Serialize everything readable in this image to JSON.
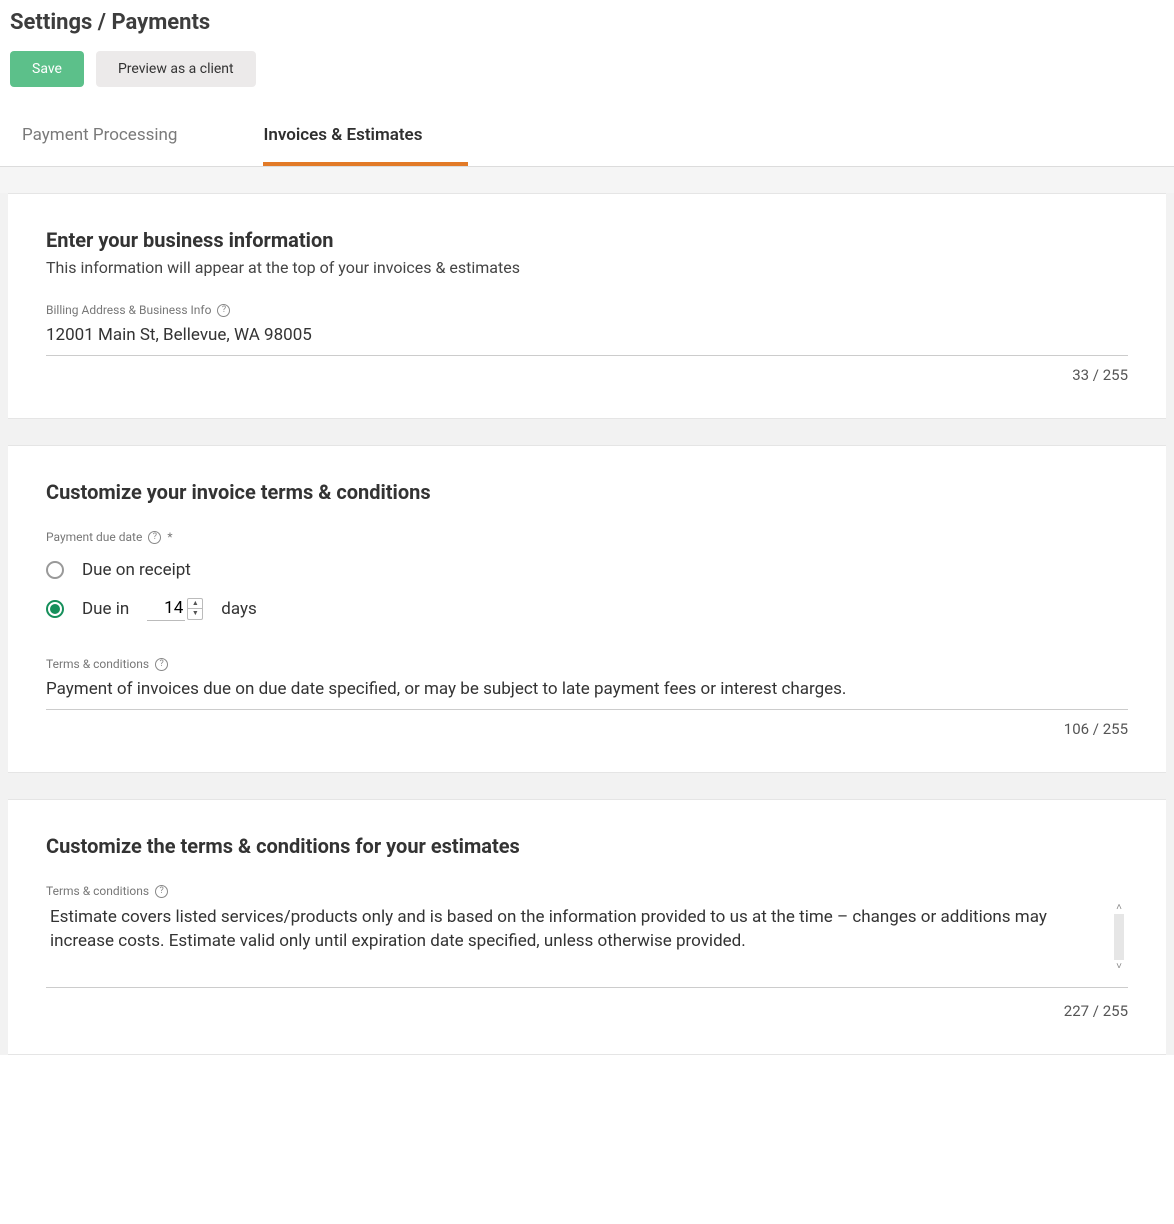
{
  "header": {
    "breadcrumb": "Settings / Payments",
    "save_label": "Save",
    "preview_label": "Preview as a client"
  },
  "tabs": [
    {
      "label": "Payment Processing",
      "active": false
    },
    {
      "label": "Invoices & Estimates",
      "active": true
    }
  ],
  "business_info": {
    "title": "Enter your business information",
    "subtitle": "This information will appear at the top of your invoices & estimates",
    "field_label": "Billing Address & Business Info",
    "value": "12001 Main St, Bellevue, WA 98005",
    "counter": "33 / 255"
  },
  "invoice_terms": {
    "title": "Customize your invoice terms & conditions",
    "due_date_label": "Payment due date",
    "required_mark": "*",
    "option_receipt_label": "Due on receipt",
    "option_duein_prefix": "Due in",
    "option_duein_value": "14",
    "option_duein_suffix": "days",
    "selected": "duein",
    "tc_label": "Terms & conditions",
    "tc_value": "Payment of invoices due on due date specified, or may be subject to late payment fees or interest charges.",
    "tc_counter": "106 / 255"
  },
  "estimate_terms": {
    "title": "Customize the terms & conditions for your estimates",
    "tc_label": "Terms & conditions",
    "tc_value": "Estimate covers listed services/products only and is based on the information provided to us at the time – changes or additions may increase costs. Estimate valid only until expiration date specified, unless otherwise provided.",
    "tc_counter": "227 / 255"
  }
}
